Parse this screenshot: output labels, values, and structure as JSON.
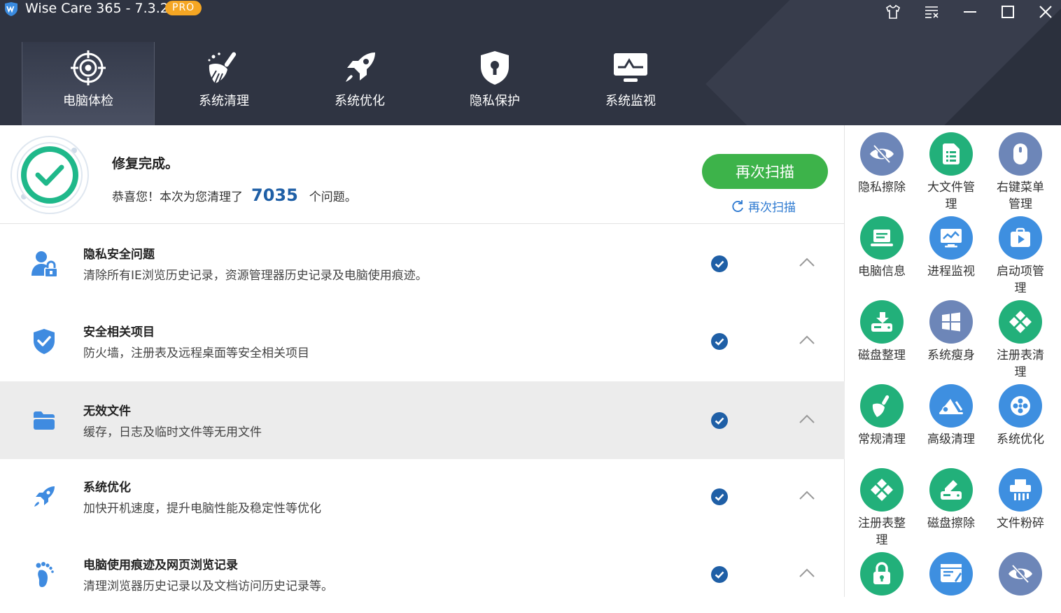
{
  "titlebar": {
    "title": "Wise Care 365 - 7.3.2",
    "badge": "PRO",
    "buttons": [
      "skin-icon",
      "menu-icon",
      "minimize-icon",
      "maximize-icon",
      "close-icon"
    ]
  },
  "tabs": [
    {
      "label": "电脑体检",
      "icon": "target-icon",
      "active": true
    },
    {
      "label": "系统清理",
      "icon": "broom-icon",
      "active": false
    },
    {
      "label": "系统优化",
      "icon": "rocket-icon",
      "active": false
    },
    {
      "label": "隐私保护",
      "icon": "shield-lock-icon",
      "active": false
    },
    {
      "label": "系统监视",
      "icon": "monitor-icon",
      "active": false
    }
  ],
  "summary": {
    "title": "修复完成。",
    "msg_before": "恭喜您！本次为您清理了",
    "count": "7035",
    "msg_after": "个问题。",
    "rescan_button": "再次扫描",
    "rescan_link": "再次扫描"
  },
  "issues": [
    {
      "title": "隐私安全问题",
      "desc": "清除所有IE浏览历史记录，资源管理器历史记录及电脑使用痕迹。",
      "icon": "user-lock-icon"
    },
    {
      "title": "安全相关项目",
      "desc": "防火墙，注册表及远程桌面等安全相关项目",
      "icon": "shield-check-icon"
    },
    {
      "title": "无效文件",
      "desc": "缓存，日志及临时文件等无用文件",
      "icon": "folder-icon"
    },
    {
      "title": "系统优化",
      "desc": "加快开机速度，提升电脑性能及稳定性等优化",
      "icon": "rocket-icon"
    },
    {
      "title": "电脑使用痕迹及网页浏览记录",
      "desc": "清理浏览器历史记录以及文档访问历史记录等。",
      "icon": "footprint-icon"
    }
  ],
  "tools": [
    {
      "label": "隐私擦除",
      "icon": "eye-slash-icon",
      "color": "#6d86b8"
    },
    {
      "label": "大文件管理",
      "icon": "file-list-icon",
      "color": "#22b07a"
    },
    {
      "label": "右键菜单管理",
      "icon": "mouse-icon",
      "color": "#6d86b8"
    },
    {
      "label": "电脑信息",
      "icon": "laptop-icon",
      "color": "#22b07a"
    },
    {
      "label": "进程监视",
      "icon": "chart-monitor-icon",
      "color": "#3e8fe0"
    },
    {
      "label": "启动项管理",
      "icon": "startup-icon",
      "color": "#3e8fe0"
    },
    {
      "label": "磁盘整理",
      "icon": "disk-defrag-icon",
      "color": "#22b07a"
    },
    {
      "label": "系统瘦身",
      "icon": "windows-icon",
      "color": "#6d86b8"
    },
    {
      "label": "注册表清理",
      "icon": "registry-clean-icon",
      "color": "#22b07a"
    },
    {
      "label": "常规清理",
      "icon": "broom-icon",
      "color": "#22b07a"
    },
    {
      "label": "高级清理",
      "icon": "advanced-clean-icon",
      "color": "#3e8fe0"
    },
    {
      "label": "系统优化",
      "icon": "optimize-icon",
      "color": "#3e8fe0"
    },
    {
      "label": "注册表整理",
      "icon": "registry-defrag-icon",
      "color": "#22b07a"
    },
    {
      "label": "磁盘擦除",
      "icon": "disk-eraser-icon",
      "color": "#22b07a"
    },
    {
      "label": "文件粉碎",
      "icon": "shredder-icon",
      "color": "#3e8fe0"
    },
    {
      "label": "",
      "icon": "lock-icon",
      "color": "#22b07a"
    },
    {
      "label": "",
      "icon": "browser-clean-icon",
      "color": "#3e8fe0"
    },
    {
      "label": "",
      "icon": "eye-slash-icon",
      "color": "#6d86b8"
    }
  ]
}
